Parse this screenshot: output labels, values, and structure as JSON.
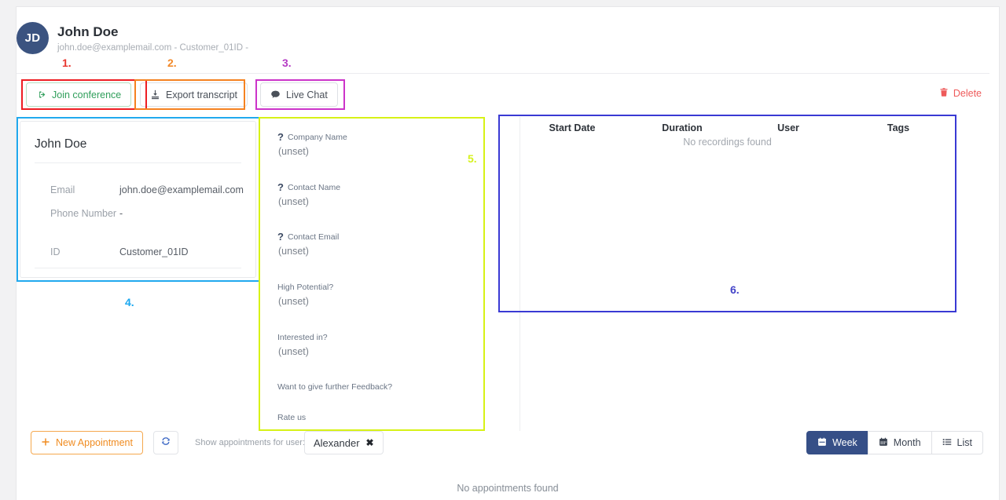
{
  "header": {
    "avatar_initials": "JD",
    "name": "John Doe",
    "subtitle": "john.doe@examplemail.com - Customer_01ID -"
  },
  "annotations": [
    {
      "label": "1.",
      "color": "#e8352e"
    },
    {
      "label": "2.",
      "color": "#f2892a"
    },
    {
      "label": "3.",
      "color": "#b53cc4"
    },
    {
      "label": "4.",
      "color": "#1ba8f0"
    },
    {
      "label": "5.",
      "color": "#d6f21e"
    },
    {
      "label": "6.",
      "color": "#4343c8"
    }
  ],
  "actions": {
    "join_conference": "Join conference",
    "export_transcript": "Export transcript",
    "live_chat": "Live Chat",
    "delete": "Delete"
  },
  "info_card": {
    "title": "John Doe",
    "rows": [
      {
        "key": "Email",
        "value": "john.doe@examplemail.com"
      },
      {
        "key": "Phone Number",
        "value": "-"
      },
      {
        "key": "ID",
        "value": "Customer_01ID"
      }
    ]
  },
  "questions": [
    {
      "label": "Company Name",
      "value": "(unset)",
      "has_mark": true
    },
    {
      "label": "Contact Name",
      "value": "(unset)",
      "has_mark": true
    },
    {
      "label": "Contact Email",
      "value": "(unset)",
      "has_mark": true
    },
    {
      "label": "High Potential?",
      "value": "(unset)",
      "has_mark": false
    },
    {
      "label": "Interested in?",
      "value": "(unset)",
      "has_mark": false
    },
    {
      "label": "Want to give further Feedback?",
      "value": "",
      "has_mark": false
    },
    {
      "label": "Rate us",
      "value": "",
      "has_mark": false
    }
  ],
  "recordings": {
    "columns": [
      "Start Date",
      "Duration",
      "User",
      "Tags"
    ],
    "rows": [],
    "empty_message": "No recordings found"
  },
  "bottom_bar": {
    "new_appointment": "New Appointment",
    "refresh_icon": "refresh-icon",
    "show_for_user_label": "Show appointments for user:",
    "selected_user": "Alexander",
    "views": [
      {
        "label": "Week",
        "icon": "calendar-week-icon",
        "active": true
      },
      {
        "label": "Month",
        "icon": "calendar-month-icon",
        "active": false
      },
      {
        "label": "List",
        "icon": "list-icon",
        "active": false
      }
    ],
    "empty_message": "No appointments found"
  },
  "colors": {
    "primary": "#364f87",
    "accent_orange": "#f08c21",
    "danger": "#ee5a5a",
    "success": "#2f9e5a"
  }
}
